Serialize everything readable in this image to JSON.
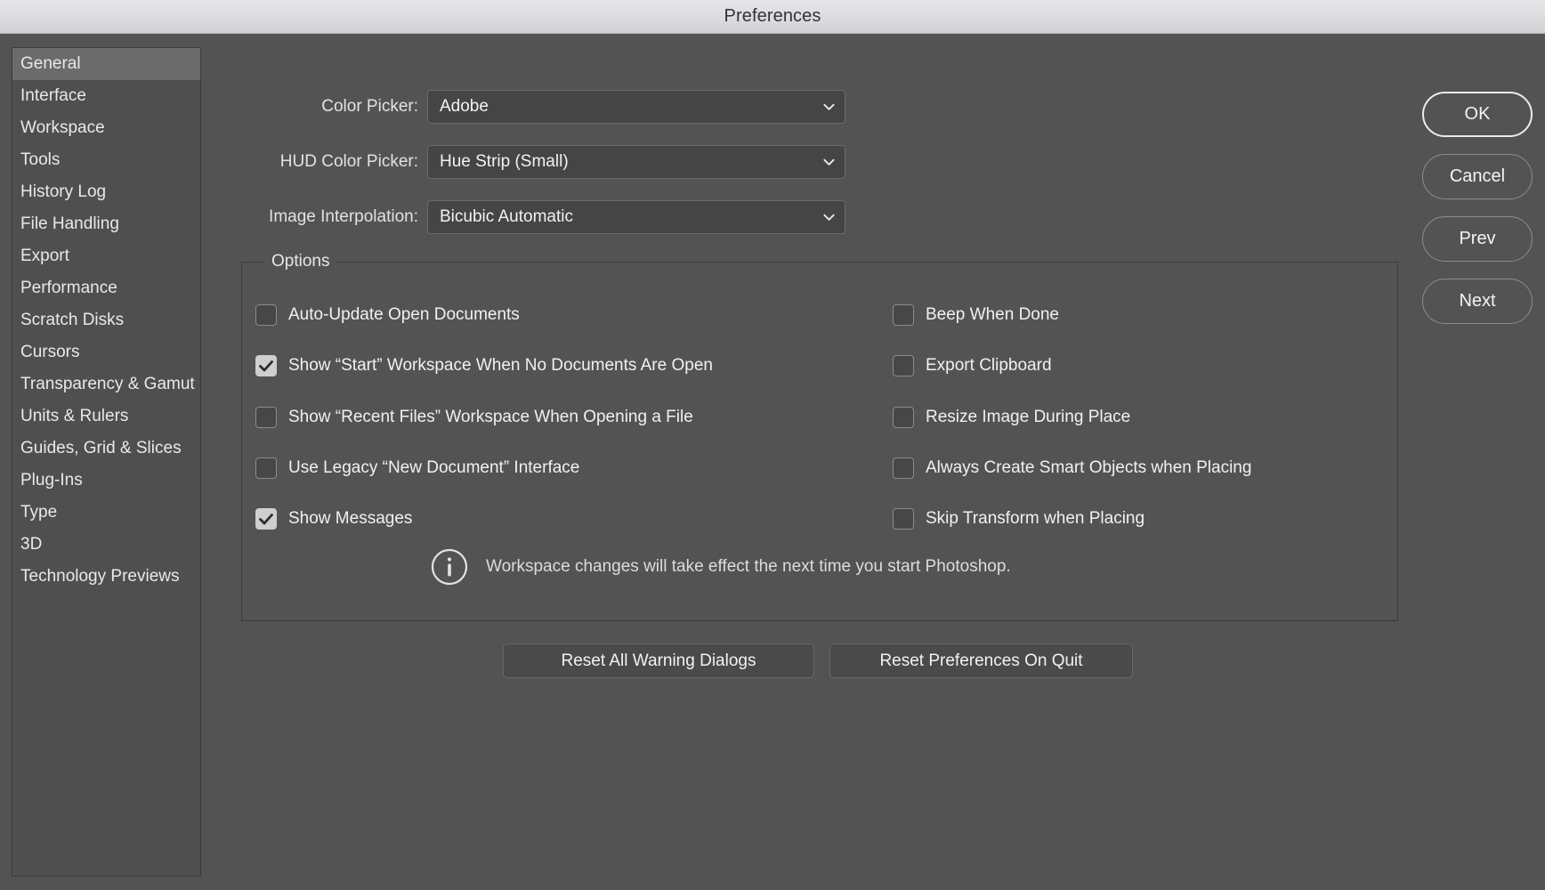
{
  "window": {
    "title": "Preferences"
  },
  "sidebar": {
    "items": [
      {
        "label": "General",
        "selected": true
      },
      {
        "label": "Interface",
        "selected": false
      },
      {
        "label": "Workspace",
        "selected": false
      },
      {
        "label": "Tools",
        "selected": false
      },
      {
        "label": "History Log",
        "selected": false
      },
      {
        "label": "File Handling",
        "selected": false
      },
      {
        "label": "Export",
        "selected": false
      },
      {
        "label": "Performance",
        "selected": false
      },
      {
        "label": "Scratch Disks",
        "selected": false
      },
      {
        "label": "Cursors",
        "selected": false
      },
      {
        "label": "Transparency & Gamut",
        "selected": false
      },
      {
        "label": "Units & Rulers",
        "selected": false
      },
      {
        "label": "Guides, Grid & Slices",
        "selected": false
      },
      {
        "label": "Plug-Ins",
        "selected": false
      },
      {
        "label": "Type",
        "selected": false
      },
      {
        "label": "3D",
        "selected": false
      },
      {
        "label": "Technology Previews",
        "selected": false
      }
    ]
  },
  "form": {
    "rows": [
      {
        "label": "Color Picker:",
        "value": "Adobe"
      },
      {
        "label": "HUD Color Picker:",
        "value": "Hue Strip (Small)"
      },
      {
        "label": "Image Interpolation:",
        "value": "Bicubic Automatic"
      }
    ]
  },
  "options": {
    "legend": "Options",
    "left_column": [
      {
        "label": "Auto-Update Open Documents",
        "checked": false
      },
      {
        "label": "Show “Start” Workspace When No Documents Are Open",
        "checked": true
      },
      {
        "label": "Show “Recent Files” Workspace When Opening a File",
        "checked": false
      },
      {
        "label": "Use Legacy “New Document” Interface",
        "checked": false
      },
      {
        "label": "Show Messages",
        "checked": true
      }
    ],
    "right_column": [
      {
        "label": "Beep When Done",
        "checked": false
      },
      {
        "label": "Export Clipboard",
        "checked": false
      },
      {
        "label": "Resize Image During Place",
        "checked": false
      },
      {
        "label": "Always Create Smart Objects when Placing",
        "checked": false
      },
      {
        "label": "Skip Transform when Placing",
        "checked": false
      }
    ],
    "note": "Workspace changes will take effect the next time you start Photoshop."
  },
  "reset_buttons": [
    {
      "label": "Reset All Warning Dialogs"
    },
    {
      "label": "Reset Preferences On Quit"
    }
  ],
  "actions": [
    {
      "label": "OK",
      "default": true
    },
    {
      "label": "Cancel",
      "default": false
    },
    {
      "label": "Prev",
      "default": false
    },
    {
      "label": "Next",
      "default": false
    }
  ],
  "colors": {
    "dialog_bg": "#535353",
    "titlebar_bg": "#dcdcdf",
    "panel_bg": "#4f4f4f",
    "selected_row": "#6b6b6b",
    "text": "#f1f1f1",
    "field_bg": "#454545",
    "checkbox_on": "#cfcfcf"
  }
}
